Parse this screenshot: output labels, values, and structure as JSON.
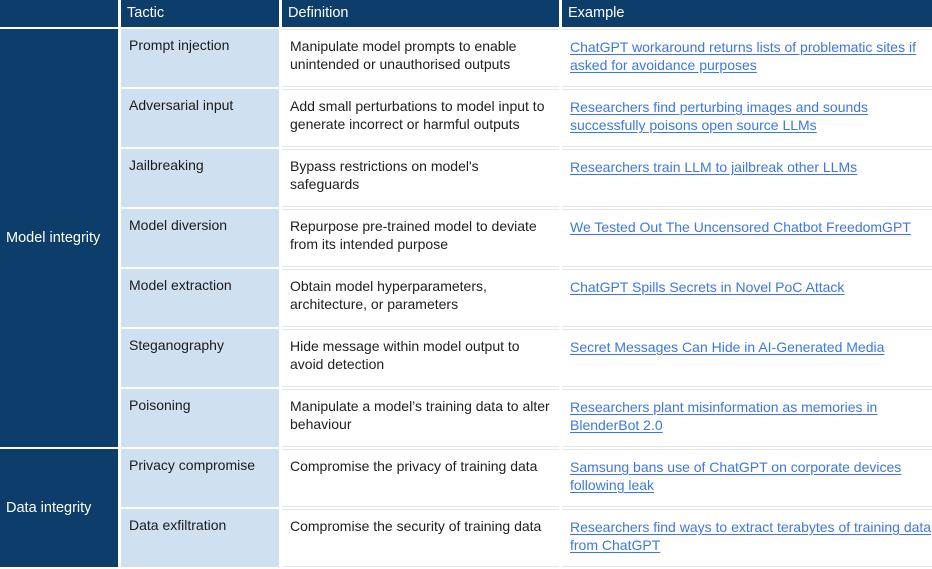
{
  "table": {
    "columns": [
      {
        "key": "category",
        "label": ""
      },
      {
        "key": "tactic",
        "label": "Tactic"
      },
      {
        "key": "definition",
        "label": "Definition"
      },
      {
        "key": "example",
        "label": "Example"
      }
    ],
    "colors": {
      "header_background": "#0d3d6b",
      "category_background": "#0d3d6b",
      "category_text": "#ffffff",
      "tactic_background": "#cfe0f1",
      "cell_background": "#ffffff",
      "link": "#3b78e7",
      "row_divider": "#e6e6e6"
    },
    "categories": [
      {
        "label": "Model integrity",
        "row_span": 7
      },
      {
        "label": "Data integrity",
        "row_span": 2
      }
    ],
    "rows": [
      {
        "category": "Model integrity",
        "tactic": "Prompt injection",
        "definition": "Manipulate model prompts to enable unintended or unauthorised outputs",
        "example": "ChatGPT workaround returns lists of problematic sites if asked for avoidance purposes"
      },
      {
        "category": "Model integrity",
        "tactic": "Adversarial input",
        "definition": "Add small perturbations to model input to generate incorrect or harmful outputs",
        "example": "Researchers find perturbing images and sounds successfully poisons open source LLMs"
      },
      {
        "category": "Model integrity",
        "tactic": "Jailbreaking",
        "definition": "Bypass restrictions on model's safeguards",
        "example": "Researchers train LLM to jailbreak other LLMs"
      },
      {
        "category": "Model integrity",
        "tactic": "Model diversion",
        "definition": "Repurpose pre-trained model to deviate from its intended purpose",
        "example": "We Tested Out The Uncensored Chatbot FreedomGPT"
      },
      {
        "category": "Model integrity",
        "tactic": "Model extraction",
        "definition": "Obtain model hyperparameters, architecture, or parameters",
        "example": "ChatGPT Spills Secrets in Novel PoC Attack"
      },
      {
        "category": "Model integrity",
        "tactic": "Steganography",
        "definition": "Hide message within model output to avoid detection",
        "example": "Secret Messages Can Hide in AI-Generated Media"
      },
      {
        "category": "Model integrity",
        "tactic": "Poisoning",
        "definition": "Manipulate a model’s training data to alter behaviour",
        "example": "Researchers plant misinformation as memories in BlenderBot 2.0"
      },
      {
        "category": "Data integrity",
        "tactic": "Privacy compromise",
        "definition": "Compromise the privacy of training data",
        "example": "Samsung bans use of ChatGPT on corporate devices following leak"
      },
      {
        "category": "Data integrity",
        "tactic": "Data exfiltration",
        "definition": "Compromise the security of training data",
        "example": "Researchers find ways to extract terabytes of training data from ChatGPT"
      }
    ]
  }
}
